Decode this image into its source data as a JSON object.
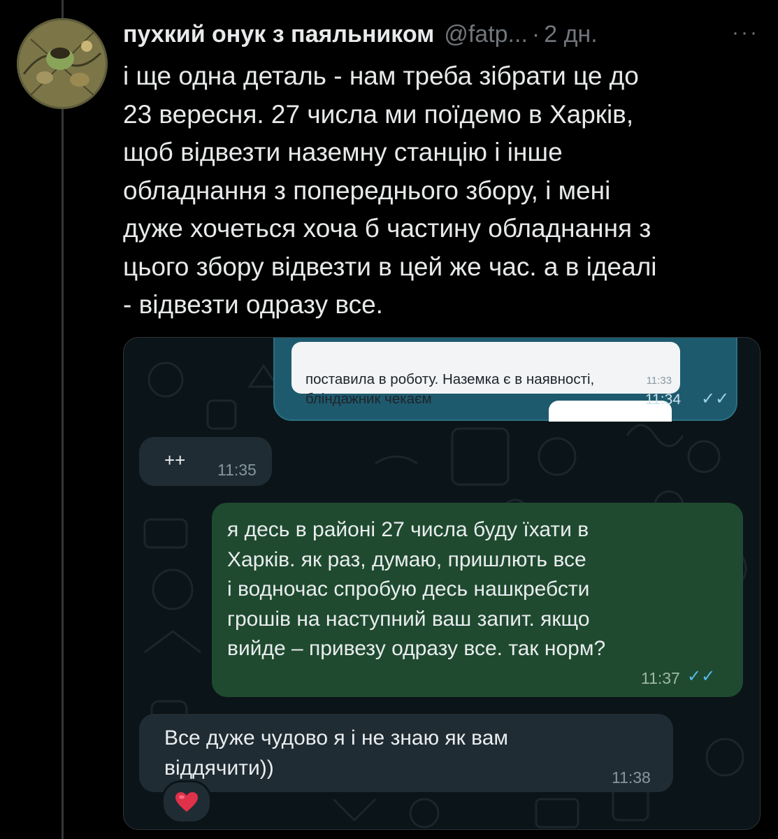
{
  "tweet": {
    "author_name": "пухкий онук з паяльником",
    "handle": "@fatp...",
    "separator": "·",
    "time": "2 дн.",
    "more_label": "···",
    "text": "і ще одна деталь - нам треба зібрати це до\n23 вересня. 27 числа ми поїдемо в Харків,\nщоб відвезти наземну станцію і інше\nобладнання з попереднього збору, і мені\nдуже хочеться хоча б частину обладнання з\nцього збору відвезти в цей же час. а в ідеалі\n- відвезти одразу все."
  },
  "chat": {
    "quoted": {
      "text": "поставила в роботу. Наземка є в наявності,\nбліндажник чекаєм",
      "time_inner": "11:33",
      "time_outer": "11:34"
    },
    "messages": [
      {
        "direction": "in",
        "text": "++",
        "time": "11:35"
      },
      {
        "direction": "out",
        "text": "я десь в районі 27 числа буду їхати в\nХарків. як раз, думаю, пришлють все\nі водночас спробую десь нашкребсти\nгрошів на наступний ваш запит. якщо\nвийде – привезу одразу все. так норм?",
        "time": "11:37",
        "status_icon": "double-check-icon"
      },
      {
        "direction": "in",
        "text": "Все дуже чудово я і не знаю як вам\nвіддячити))",
        "time": "11:38"
      }
    ],
    "reaction": "❤️"
  },
  "colors": {
    "background": "#000000",
    "chat_background": "#0b1418",
    "incoming_bubble": "#202c33",
    "outgoing_bubble": "#1f4a2f",
    "read_check": "#53bdeb"
  }
}
